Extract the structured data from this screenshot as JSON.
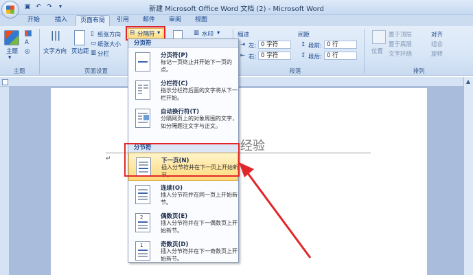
{
  "window": {
    "title": "新建 Microsoft Office Word 文档 (2) - Microsoft Word"
  },
  "tabs": [
    "开始",
    "插入",
    "页面布局",
    "引用",
    "邮件",
    "审阅",
    "视图"
  ],
  "active_tab": "页面布局",
  "ribbon": {
    "theme": {
      "label": "主题",
      "group": "主题"
    },
    "page_setup": {
      "group": "页面设置",
      "text_direction": "文字方向",
      "margins": "页边距",
      "orientation": "纸张方向",
      "size": "纸张大小",
      "columns": "分栏",
      "breaks": "分隔符"
    },
    "background": {
      "watermark": "水印"
    },
    "paragraph": {
      "group": "段落",
      "indent": "缩进",
      "spacing": "间距",
      "left_abbr": "左:",
      "right_abbr": "右:",
      "before": "段前:",
      "after": "段后:",
      "indent_left_value": "0 字符",
      "indent_right_value": "0 字符",
      "spacing_before_value": "0 行",
      "spacing_after_value": "0 行"
    },
    "arrange": {
      "group": "排列",
      "position": "位置",
      "bring_front": "置于顶层",
      "send_back": "置于底层",
      "wrap": "文字环绕",
      "align": "对齐",
      "group_btn": "组合",
      "rotate": "旋转"
    }
  },
  "document": {
    "visible_text": "经验"
  },
  "breaks_menu": {
    "page_breaks_header": "分页符",
    "section_breaks_header": "分节符",
    "page_items": [
      {
        "title": "分页符(P)",
        "desc": "标记一页终止并开始下一页的点。"
      },
      {
        "title": "分栏符(C)",
        "desc": "指示分栏符后面的文字将从下一栏开始。"
      },
      {
        "title": "自动换行符(T)",
        "desc": "分隔网页上的对象周围的文字，如分隔题注文字与正文。"
      }
    ],
    "section_items": [
      {
        "title": "下一页(N)",
        "desc": "插入分节符并在下一页上开始新节。"
      },
      {
        "title": "连续(O)",
        "desc": "插入分节符并在同一页上开始新节。"
      },
      {
        "title": "偶数页(E)",
        "desc": "插入分节符并在下一偶数页上开始新节。"
      },
      {
        "title": "奇数页(D)",
        "desc": "插入分节符并在下一奇数页上开始新节。"
      }
    ]
  },
  "colors": {
    "highlight": "#ffd97a",
    "annotation": "#e1262b",
    "ribbon": "#dbe7f6"
  }
}
